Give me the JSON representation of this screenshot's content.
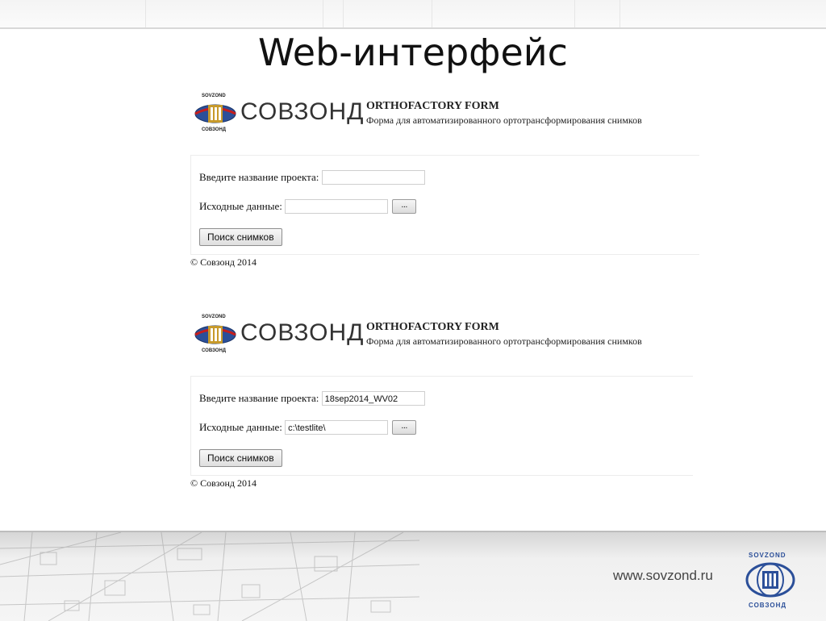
{
  "slide": {
    "title": "Web-интерфейс",
    "site": "www.sovzond.ru",
    "corner_logo_top": "SOVZOND",
    "corner_logo_bottom": "СОВЗОНД"
  },
  "colors": {
    "accent_blue": "#2b4f99",
    "logo_red": "#c41e1e",
    "logo_gold": "#c79a2b"
  },
  "forms": [
    {
      "logo_small_top": "SOVZOND",
      "logo_word": "СОВЗОНД",
      "logo_small_bottom": "СОВЗОНД",
      "header_title": "ORTHOFACTORY FORM",
      "header_subtitle": "Форма для автоматизированного ортотрансформирования снимков",
      "project_label": "Введите название проекта:",
      "project_value": "",
      "source_label": "Исходные данные:",
      "source_value": "",
      "browse_label": "...",
      "search_button": "Поиск снимков",
      "copyright": "© Совзонд 2014"
    },
    {
      "logo_small_top": "SOVZOND",
      "logo_word": "СОВЗОНД",
      "logo_small_bottom": "СОВЗОНД",
      "header_title": "ORTHOFACTORY FORM",
      "header_subtitle": "Форма для автоматизированного ортотрансформирования снимков",
      "project_label": "Введите название проекта:",
      "project_value": "18sep2014_WV02",
      "source_label": "Исходные данные:",
      "source_value": "c:\\testlite\\",
      "browse_label": "...",
      "search_button": "Поиск снимков",
      "copyright": "© Совзонд 2014"
    }
  ]
}
